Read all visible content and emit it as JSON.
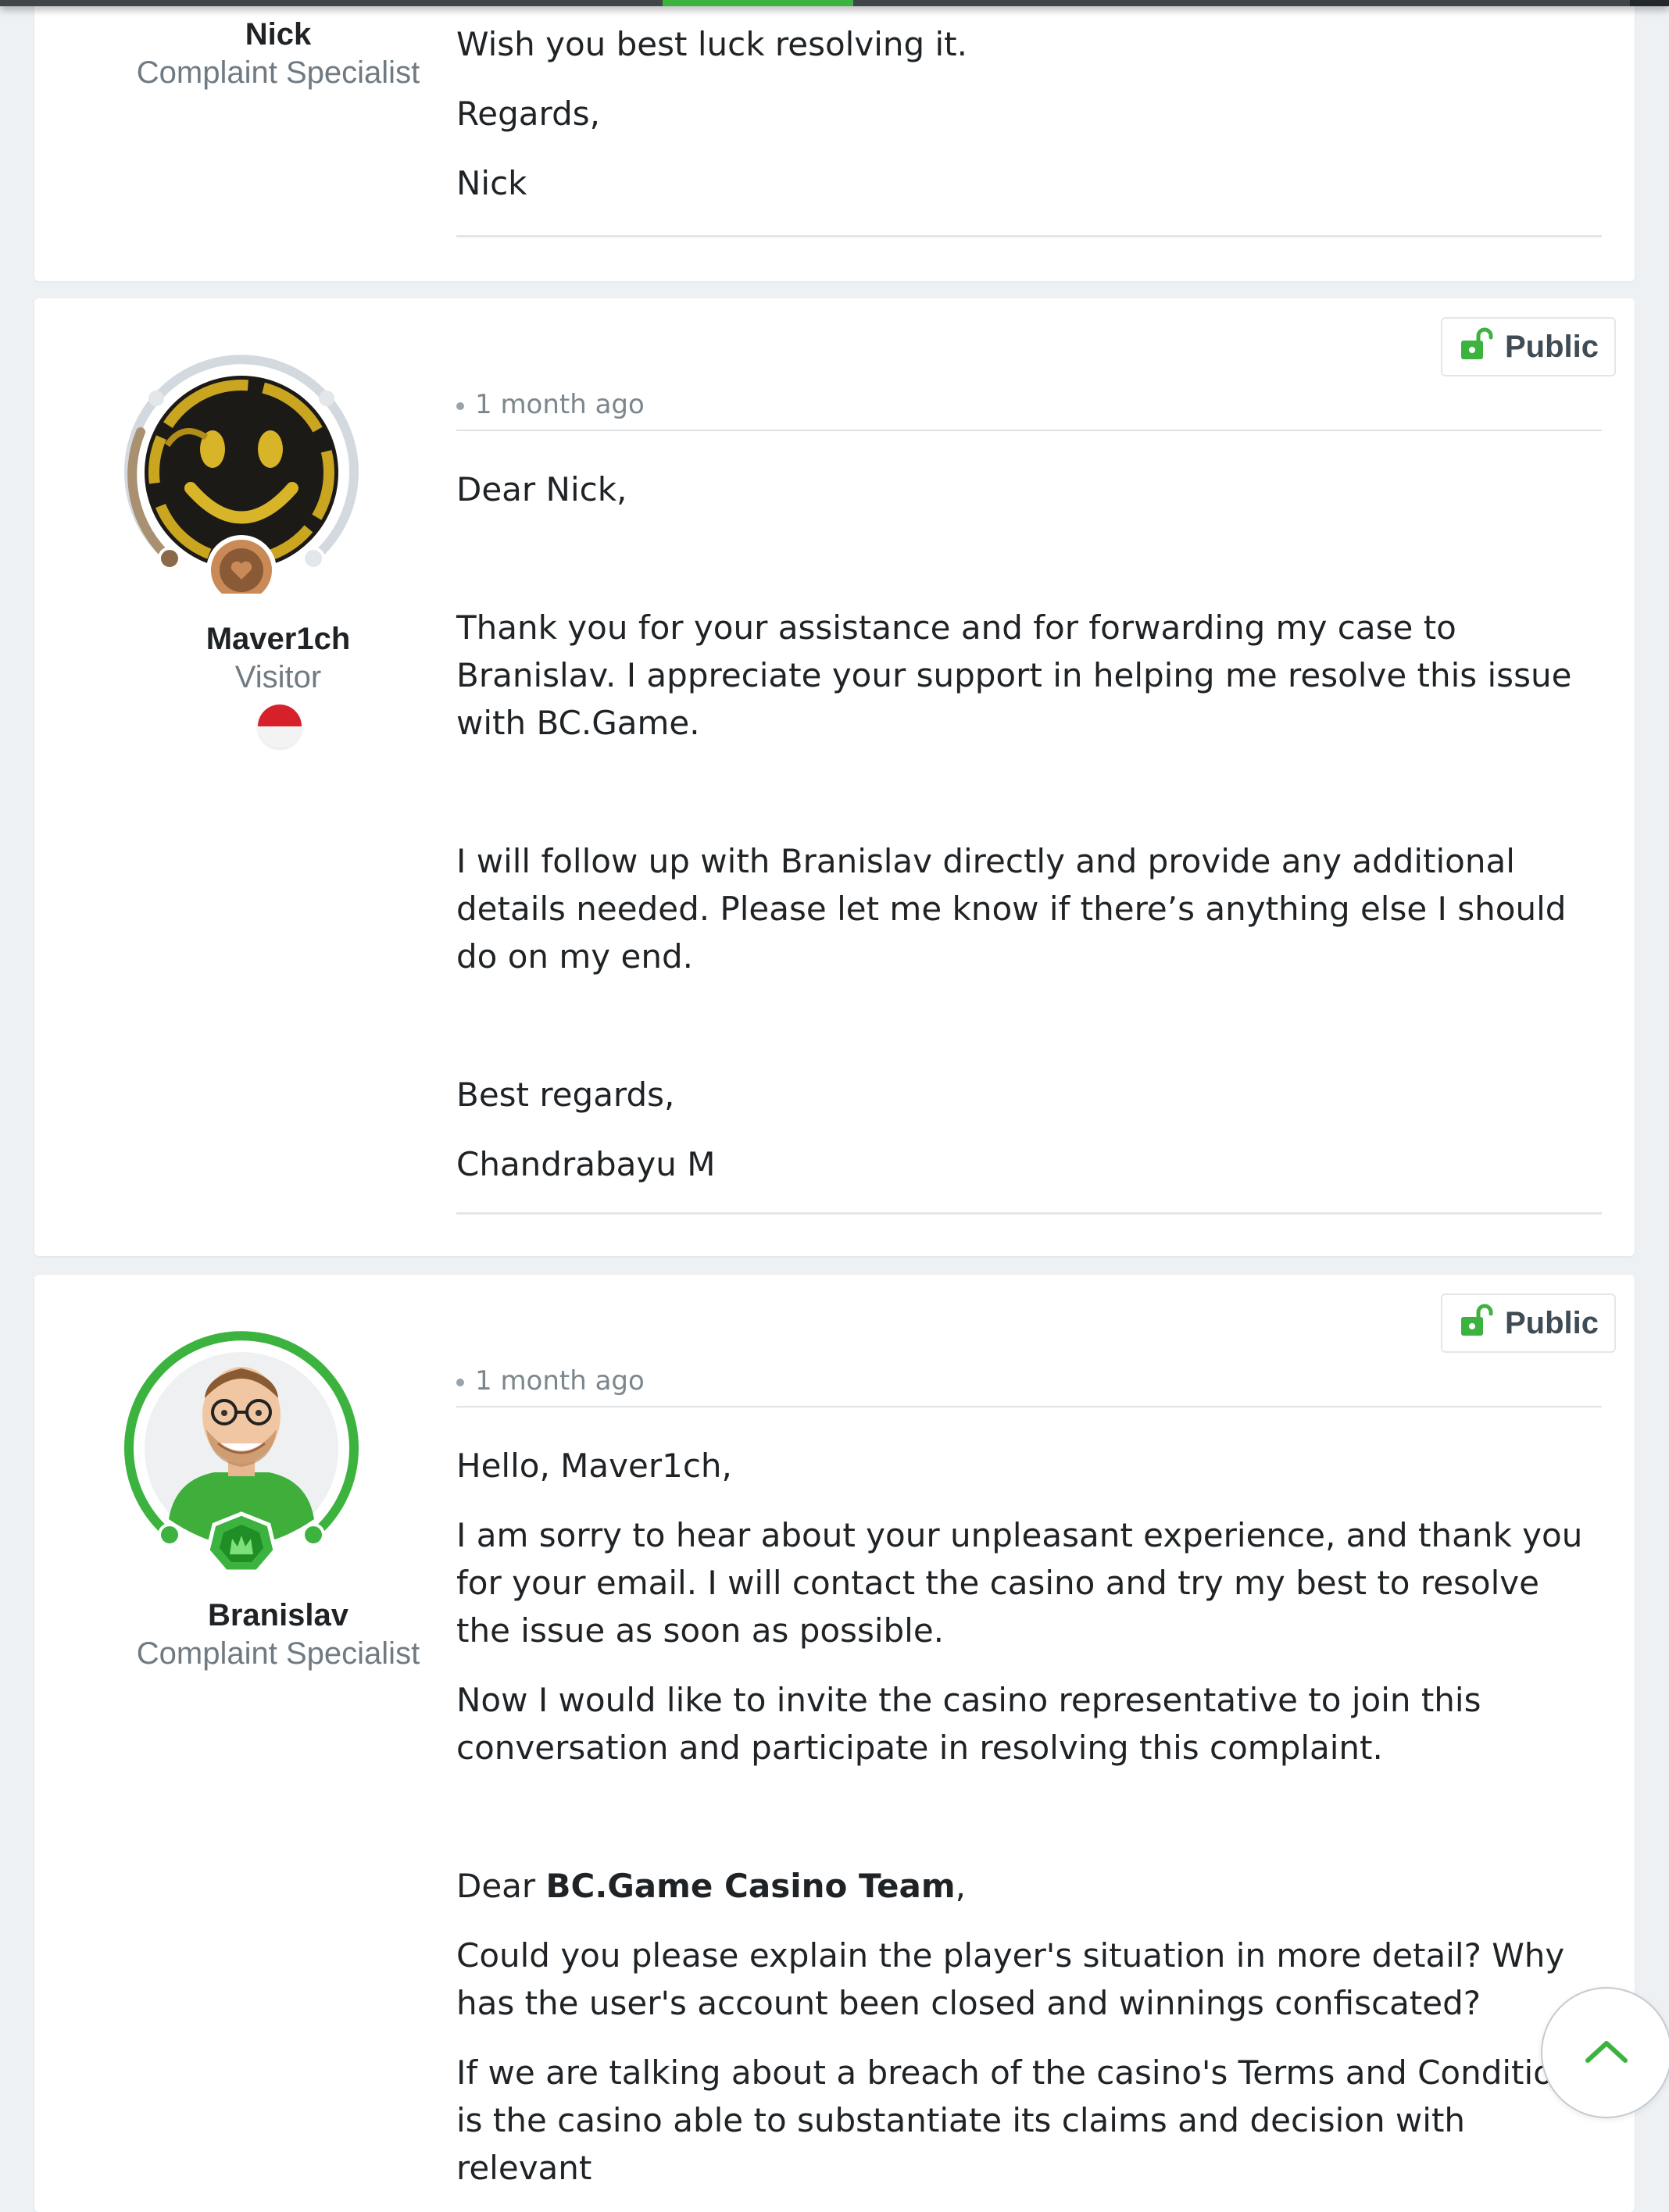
{
  "posts": [
    {
      "author": "Nick",
      "role": "Complaint Specialist",
      "lines": [
        "Wish you best luck resolving it.",
        "Regards,",
        "Nick"
      ]
    },
    {
      "author": "Maver1ch",
      "role": "Visitor",
      "visibility": "Public",
      "time": "1 month ago",
      "greeting": "Dear Nick,",
      "para1": "Thank you for your assistance and for forwarding my case to Branislav. I appreciate your support in helping me resolve this issue with BC.Game.",
      "para2": "I will follow up with Branislav directly and provide any additional details needed. Please let me know if there’s anything else I should do on my end.",
      "closing": "Best regards,",
      "signature": "Chandrabayu M"
    },
    {
      "author": "Branislav",
      "role": "Complaint Specialist",
      "visibility": "Public",
      "time": "1 month ago",
      "greeting": "Hello, Maver1ch,",
      "para1": "I am sorry to hear about your unpleasant experience, and thank you for your email. I will contact the casino and try my best to resolve the issue as soon as possible.",
      "para2": "Now I would like to invite the casino representative to join this conversation and participate in resolving this complaint.",
      "dear": "Dear ",
      "team": "BC.Game Casino Team",
      "comma": ",",
      "para3": "Could you please explain the player's situation in more detail? Why has the user's account been closed and winnings confiscated?",
      "para4": "If we are talking about a breach of the casino's Terms and Conditions, is the casino able to substantiate its claims and decision with relevant"
    }
  ],
  "colors": {
    "accent": "#3cb33f",
    "badge_icon": "#3cb33f",
    "muted": "#6f7a82",
    "text": "#1f2326"
  },
  "icons": {
    "public": "unlocked-padlock-icon",
    "scroll_top": "chevron-up-icon"
  }
}
